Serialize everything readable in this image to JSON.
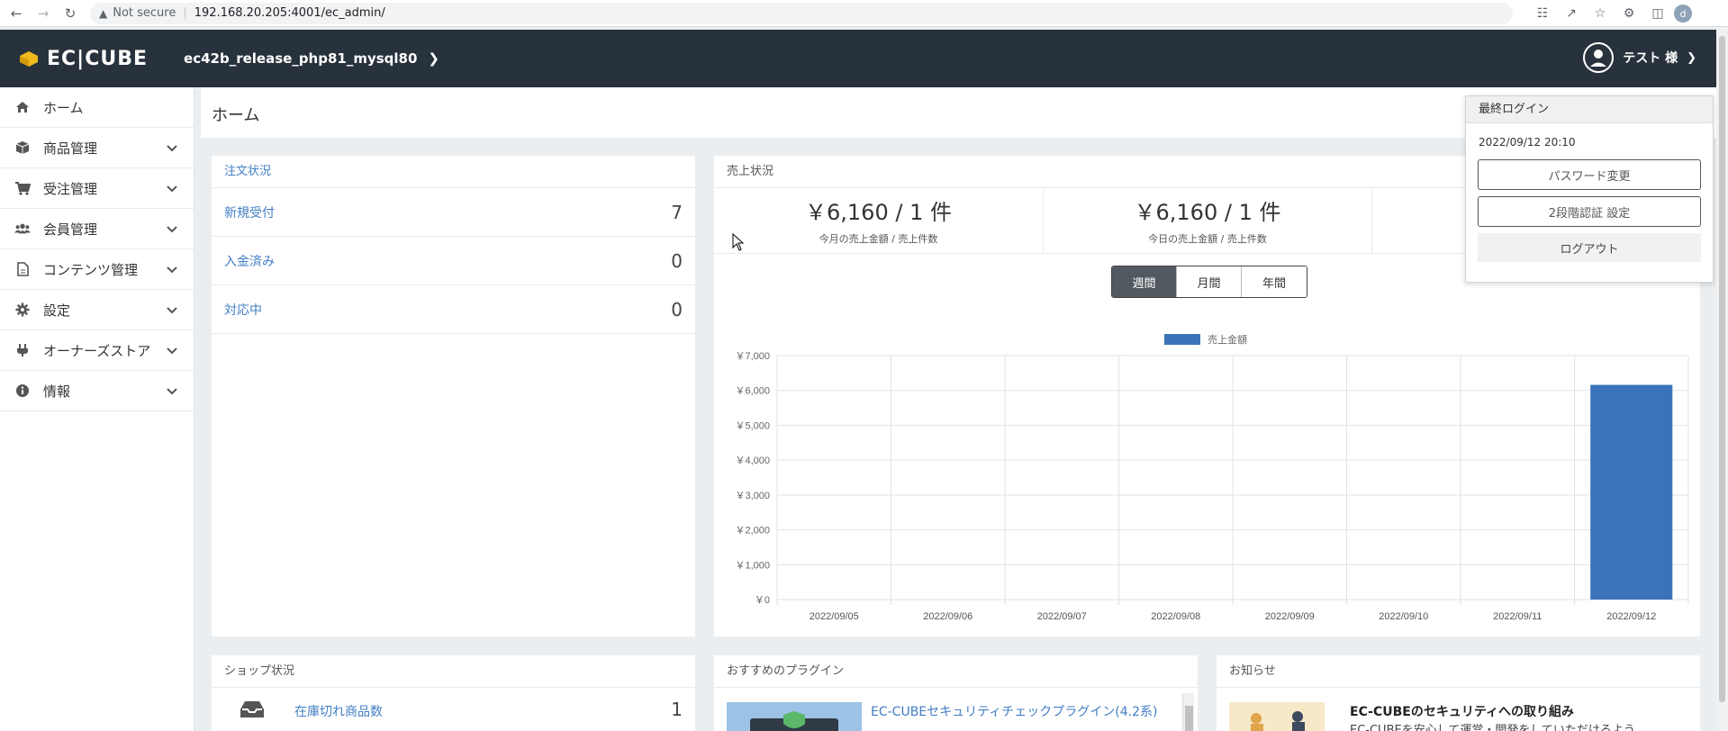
{
  "browser": {
    "security_label": "Not secure",
    "url": "192.168.20.205:4001/ec_admin/",
    "profile_initial": "d"
  },
  "header": {
    "logo_text": "EC|CUBE",
    "shop_name": "ec42b_release_php81_mysql80",
    "user_name": "テスト 様"
  },
  "sidebar": {
    "items": [
      {
        "label": "ホーム",
        "icon": "home-icon"
      },
      {
        "label": "商品管理",
        "icon": "box-icon"
      },
      {
        "label": "受注管理",
        "icon": "cart-icon"
      },
      {
        "label": "会員管理",
        "icon": "users-icon"
      },
      {
        "label": "コンテンツ管理",
        "icon": "file-icon"
      },
      {
        "label": "設定",
        "icon": "gear-icon"
      },
      {
        "label": "オーナーズストア",
        "icon": "plug-icon"
      },
      {
        "label": "情報",
        "icon": "info-icon"
      }
    ]
  },
  "page": {
    "title": "ホーム"
  },
  "orders": {
    "title": "注文状況",
    "rows": [
      {
        "label": "新規受付",
        "count": "7"
      },
      {
        "label": "入金済み",
        "count": "0"
      },
      {
        "label": "対応中",
        "count": "0"
      }
    ]
  },
  "sales": {
    "title": "売上状況",
    "month_amount": "￥6,160 / 1 件",
    "month_caption": "今月の売上金額 / 売上件数",
    "today_amount": "￥6,160 / 1 件",
    "today_caption": "今日の売上金額 / 売上件数",
    "periods": {
      "week": "週間",
      "month": "月間",
      "year": "年間"
    },
    "legend": "売上金額"
  },
  "popover": {
    "title": "最終ログイン",
    "date": "2022/09/12 20:10",
    "password_button": "パスワード変更",
    "two_factor_button": "2段階認証 設定",
    "logout_button": "ログアウト"
  },
  "shop": {
    "title": "ショップ状況",
    "stock_label": "在庫切れ商品数",
    "stock_count": "1"
  },
  "plugins": {
    "title": "おすすめのプラグイン",
    "first_name": "EC-CUBEセキュリティチェックプラグイン(4.2系)"
  },
  "news": {
    "title": "お知らせ",
    "first_title": "EC-CUBEのセキュリティへの取り組み",
    "first_excerpt": "EC-CUBEを安心して運営・開発をしていただけるよう"
  },
  "colors": {
    "accent": "#3b73b9",
    "header": "#28323c",
    "link": "#437ec4"
  },
  "chart_data": {
    "type": "bar",
    "categories": [
      "2022/09/05",
      "2022/09/06",
      "2022/09/07",
      "2022/09/08",
      "2022/09/09",
      "2022/09/10",
      "2022/09/11",
      "2022/09/12"
    ],
    "series": [
      {
        "name": "売上金額",
        "values": [
          0,
          0,
          0,
          0,
          0,
          0,
          0,
          6160
        ]
      }
    ],
    "ylim": [
      0,
      7000
    ],
    "yticks": [
      "￥7,000",
      "￥6,000",
      "￥5,000",
      "￥4,000",
      "￥3,000",
      "￥2,000",
      "￥1,000",
      "￥0"
    ],
    "grid": true,
    "legend": "top-center"
  }
}
